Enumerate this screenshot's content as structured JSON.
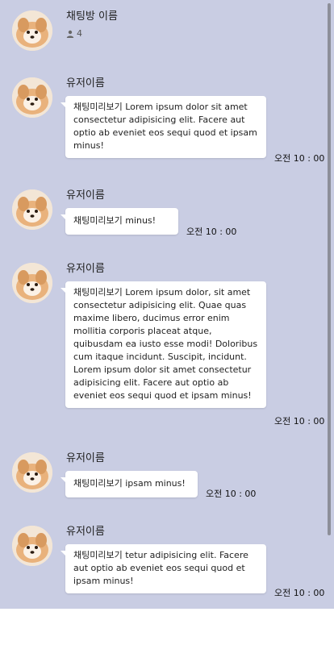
{
  "header": {
    "room_title": "채팅방 이름",
    "member_count": "4"
  },
  "messages": [
    {
      "username": "유저이름",
      "text": "채팅미리보기 Lorem ipsum dolor sit amet consectetur adipisicing elit. Facere aut optio ab eveniet eos sequi quod et ipsam minus!",
      "time": "오전 10 : 00"
    },
    {
      "username": "유저이름",
      "text": "채팅미리보기 minus!",
      "time": "오전 10 : 00"
    },
    {
      "username": "유저이름",
      "text": "채팅미리보기 Lorem ipsum dolor, sit amet consectetur adipisicing elit. Quae quas maxime libero, ducimus error enim mollitia corporis placeat atque, quibusdam ea iusto esse modi! Doloribus cum itaque incidunt. Suscipit, incidunt. Lorem ipsum dolor sit amet consectetur adipisicing elit. Facere aut optio ab eveniet eos sequi quod et ipsam minus!",
      "time": "오전 10 : 00"
    },
    {
      "username": "유저이름",
      "text": "채팅미리보기 ipsam minus!",
      "time": "오전 10 : 00"
    },
    {
      "username": "유저이름",
      "text": "채팅미리보기 tetur adipisicing elit. Facere aut optio ab eveniet eos sequi quod et ipsam minus!",
      "time": "오전 10 : 00"
    }
  ],
  "icons": {
    "avatar": "puppy-avatar-icon",
    "members": "user-icon"
  },
  "colors": {
    "chat_background": "#c9cde3",
    "bubble": "#ffffff"
  }
}
